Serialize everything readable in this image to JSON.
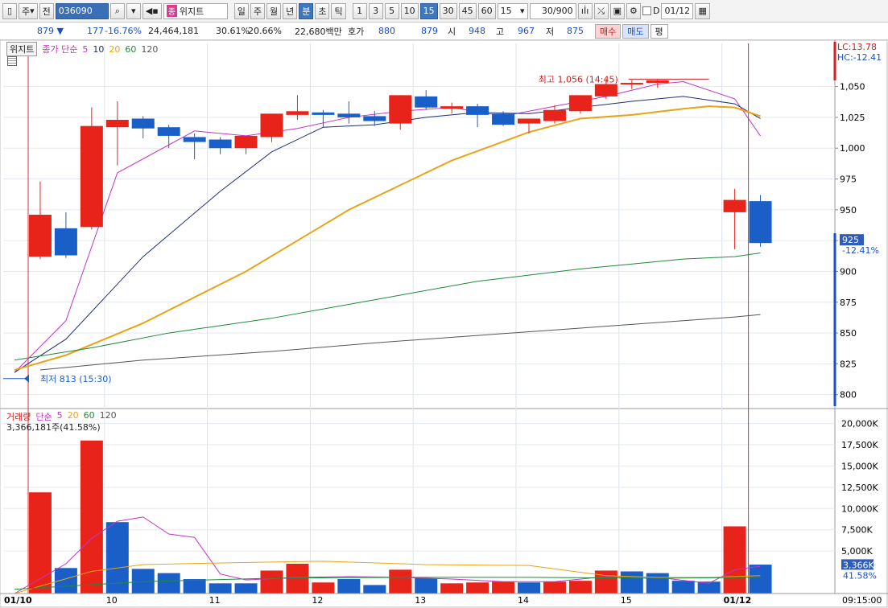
{
  "toolbar": {
    "mode": "주",
    "jeon": "전",
    "code": "036090",
    "stock_name": "위지트",
    "stock_tag": "종",
    "period_tabs": [
      "일",
      "주",
      "월",
      "년",
      "분",
      "초",
      "틱"
    ],
    "active_period": "분",
    "minute_options": [
      "1",
      "3",
      "5",
      "10",
      "15",
      "30",
      "45",
      "60"
    ],
    "active_minute": "15",
    "minute_select": "15",
    "count": "30",
    "count_max": "/900",
    "date_checkbox_label": "D",
    "date_value": "01/12"
  },
  "quote": {
    "price": "879",
    "change": "177",
    "change_pct": "-16.76%",
    "volume": "24,464,181",
    "volume_ratio": "30.61%",
    "turnover_ratio": "20.66%",
    "amount": "22,680백만",
    "hoga_label": "호가",
    "hoga_ask": "880",
    "hoga_bid": "879",
    "open_label": "시",
    "open": "948",
    "high_label": "고",
    "high": "967",
    "low_label": "저",
    "low": "875",
    "buy_label": "매수",
    "sell_label": "매도",
    "flat_label": "평"
  },
  "chart_head": {
    "name": "위지트",
    "ma_label": "종가 단순",
    "ma_periods": [
      "5",
      "10",
      "20",
      "60",
      "120"
    ]
  },
  "vol_head": {
    "name": "거래량",
    "ma_label": "단순",
    "ma_periods": [
      "5",
      "10",
      "20",
      "60",
      "120"
    ],
    "current": "3,366,181주(41.58%)"
  },
  "colors": {
    "up": "#e8231a",
    "down": "#1a5fc8",
    "ma5": "#c433c4",
    "ma10": "#1f2d7a",
    "ma20": "#e8a317",
    "ma60": "#1e8a3c",
    "ma120": "#555555",
    "day_divider": "#e03030"
  },
  "chart_data": {
    "type": "candlestick",
    "interval": "15 minutes",
    "lc": "LC:13.78",
    "hc": "HC:-12.41",
    "price_axis": {
      "ticks": [
        800,
        825,
        850,
        875,
        900,
        925,
        950,
        975,
        1000,
        1025,
        1050
      ],
      "ylim": [
        790,
        1085
      ]
    },
    "current_price_label": "925",
    "current_change_label": "-12.41%",
    "max_annotation": "최고 1,056 (14:45)",
    "max_value": 1056,
    "min_annotation": "최저 813 (15:30)",
    "min_value": 813,
    "x_labels": [
      "01/10",
      "10",
      "11",
      "12",
      "13",
      "14",
      "15",
      "01/12"
    ],
    "x_label_slots": [
      0,
      4,
      8,
      12,
      16,
      20,
      24,
      28
    ],
    "time_label": "09:15:00",
    "candles": [
      {
        "o": 912,
        "h": 973,
        "l": 910,
        "c": 946
      },
      {
        "o": 935,
        "h": 948,
        "l": 911,
        "c": 913
      },
      {
        "o": 936,
        "h": 1033,
        "l": 934,
        "c": 1018
      },
      {
        "o": 1017,
        "h": 1038,
        "l": 986,
        "c": 1023
      },
      {
        "o": 1024,
        "h": 1026,
        "l": 1008,
        "c": 1016
      },
      {
        "o": 1017,
        "h": 1019,
        "l": 1000,
        "c": 1010
      },
      {
        "o": 1009,
        "h": 1012,
        "l": 991,
        "c": 1005
      },
      {
        "o": 1007,
        "h": 1009,
        "l": 995,
        "c": 1000
      },
      {
        "o": 1000,
        "h": 1006,
        "l": 995,
        "c": 1010
      },
      {
        "o": 1009,
        "h": 1028,
        "l": 1005,
        "c": 1028
      },
      {
        "o": 1027,
        "h": 1043,
        "l": 1023,
        "c": 1030
      },
      {
        "o": 1029,
        "h": 1031,
        "l": 1017,
        "c": 1027
      },
      {
        "o": 1028,
        "h": 1038,
        "l": 1020,
        "c": 1025
      },
      {
        "o": 1026,
        "h": 1030,
        "l": 1018,
        "c": 1022
      },
      {
        "o": 1020,
        "h": 1043,
        "l": 1015,
        "c": 1043
      },
      {
        "o": 1042,
        "h": 1047,
        "l": 1031,
        "c": 1033
      },
      {
        "o": 1032,
        "h": 1037,
        "l": 1028,
        "c": 1034
      },
      {
        "o": 1034,
        "h": 1036,
        "l": 1017,
        "c": 1027
      },
      {
        "o": 1028,
        "h": 1030,
        "l": 1018,
        "c": 1019
      },
      {
        "o": 1020,
        "h": 1024,
        "l": 1012,
        "c": 1024
      },
      {
        "o": 1022,
        "h": 1035,
        "l": 1020,
        "c": 1031
      },
      {
        "o": 1030,
        "h": 1043,
        "l": 1028,
        "c": 1043
      },
      {
        "o": 1042,
        "h": 1056,
        "l": 1040,
        "c": 1052
      },
      {
        "o": 1052,
        "h": 1055,
        "l": 1048,
        "c": 1053
      },
      {
        "o": 1053,
        "h": 1056,
        "l": 1049,
        "c": 1055
      },
      {
        "o": 948,
        "h": 967,
        "l": 918,
        "c": 958
      },
      {
        "o": 957,
        "h": 962,
        "l": 920,
        "c": 923
      }
    ],
    "candle_slots": [
      1,
      2,
      3,
      4,
      5,
      6,
      7,
      8,
      9,
      10,
      11,
      12,
      13,
      14,
      15,
      16,
      17,
      18,
      19,
      20,
      21,
      22,
      23,
      24,
      25,
      28,
      29
    ],
    "ma_lines": [
      {
        "period": "5",
        "values": [
          [
            0,
            818
          ],
          [
            2,
            860
          ],
          [
            4,
            980
          ],
          [
            7,
            1014
          ],
          [
            9,
            1010
          ],
          [
            11,
            1016
          ],
          [
            13,
            1025
          ],
          [
            15,
            1030
          ],
          [
            17,
            1033
          ],
          [
            19,
            1026
          ],
          [
            21,
            1034
          ],
          [
            23,
            1042
          ],
          [
            25,
            1052
          ],
          [
            26,
            1054
          ],
          [
            28,
            1040
          ],
          [
            29,
            1010
          ]
        ]
      },
      {
        "period": "10",
        "values": [
          [
            0,
            818
          ],
          [
            2,
            845
          ],
          [
            5,
            912
          ],
          [
            8,
            965
          ],
          [
            10,
            997
          ],
          [
            12,
            1017
          ],
          [
            14,
            1019
          ],
          [
            16,
            1025
          ],
          [
            18,
            1029
          ],
          [
            20,
            1028
          ],
          [
            22,
            1033
          ],
          [
            24,
            1038
          ],
          [
            26,
            1042
          ],
          [
            28,
            1036
          ],
          [
            29,
            1024
          ]
        ]
      },
      {
        "period": "20",
        "values": [
          [
            0,
            820
          ],
          [
            2,
            832
          ],
          [
            5,
            858
          ],
          [
            9,
            900
          ],
          [
            13,
            950
          ],
          [
            17,
            990
          ],
          [
            20,
            1013
          ],
          [
            22,
            1024
          ],
          [
            24,
            1027
          ],
          [
            26,
            1032
          ],
          [
            27,
            1034
          ],
          [
            28,
            1033
          ],
          [
            29,
            1026
          ]
        ]
      },
      {
        "period": "60",
        "values": [
          [
            0,
            828
          ],
          [
            3,
            838
          ],
          [
            6,
            850
          ],
          [
            10,
            862
          ],
          [
            14,
            877
          ],
          [
            18,
            892
          ],
          [
            22,
            902
          ],
          [
            26,
            910
          ],
          [
            28,
            912
          ],
          [
            29,
            915
          ]
        ]
      },
      {
        "period": "120",
        "values": [
          [
            1,
            820
          ],
          [
            5,
            828
          ],
          [
            10,
            835
          ],
          [
            14,
            842
          ],
          [
            18,
            848
          ],
          [
            22,
            854
          ],
          [
            26,
            860
          ],
          [
            28,
            863
          ],
          [
            29,
            865
          ]
        ]
      }
    ],
    "volume_axis": {
      "ticks": [
        "5,000K",
        "7,500K",
        "10,000K",
        "12,500K",
        "15,000K",
        "17,500K",
        "20,000K"
      ],
      "tick_values": [
        5000,
        7500,
        10000,
        12500,
        15000,
        17500,
        20000
      ],
      "ylim": [
        0,
        21000
      ]
    },
    "volume_current_label": "3,366K",
    "volume_current_pct": "41.58%",
    "volumes_k": [
      11900,
      3000,
      18000,
      8400,
      2900,
      2400,
      1700,
      1200,
      1200,
      2700,
      3500,
      1300,
      1700,
      1000,
      2800,
      1800,
      1200,
      1300,
      1400,
      1300,
      1400,
      1500,
      2700,
      2600,
      2400,
      1500,
      1400,
      7900,
      3400
    ],
    "volume_slots": [
      1,
      2,
      3,
      4,
      5,
      6,
      7,
      8,
      9,
      10,
      11,
      12,
      13,
      14,
      15,
      16,
      17,
      18,
      19,
      20,
      21,
      22,
      23,
      24,
      25,
      26,
      27,
      28,
      29
    ],
    "volume_up": [
      true,
      false,
      true,
      false,
      false,
      false,
      false,
      false,
      false,
      true,
      true,
      true,
      false,
      false,
      true,
      false,
      true,
      true,
      true,
      false,
      true,
      true,
      true,
      false,
      false,
      false,
      false,
      true,
      false
    ],
    "volume_ma5": [
      [
        0,
        0
      ],
      [
        2,
        3500
      ],
      [
        3,
        6500
      ],
      [
        4,
        8500
      ],
      [
        5,
        9000
      ],
      [
        6,
        7000
      ],
      [
        7,
        6600
      ],
      [
        8,
        2300
      ],
      [
        9,
        1600
      ],
      [
        11,
        1900
      ],
      [
        13,
        2000
      ],
      [
        15,
        1900
      ],
      [
        17,
        1700
      ],
      [
        19,
        1400
      ],
      [
        21,
        1400
      ],
      [
        23,
        2000
      ],
      [
        25,
        1900
      ],
      [
        27,
        1200
      ],
      [
        28,
        2800
      ],
      [
        29,
        3200
      ]
    ],
    "volume_ma20": [
      [
        0,
        0
      ],
      [
        3,
        2600
      ],
      [
        5,
        3400
      ],
      [
        8,
        3600
      ],
      [
        12,
        3800
      ],
      [
        16,
        3400
      ],
      [
        20,
        3300
      ],
      [
        23,
        2100
      ],
      [
        25,
        1900
      ],
      [
        27,
        1900
      ],
      [
        29,
        2100
      ]
    ],
    "volume_ma60": [
      [
        0,
        500
      ],
      [
        5,
        1400
      ],
      [
        10,
        1800
      ],
      [
        15,
        1900
      ],
      [
        20,
        1900
      ],
      [
        25,
        1800
      ],
      [
        29,
        1900
      ]
    ]
  }
}
